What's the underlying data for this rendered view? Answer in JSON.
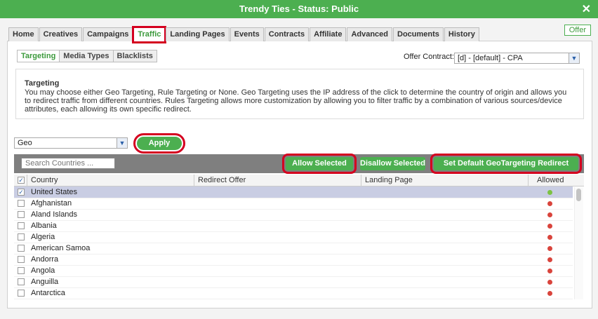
{
  "window": {
    "title": "Trendy Ties - Status: Public",
    "close": "✕"
  },
  "tabs": [
    {
      "label": "Home"
    },
    {
      "label": "Creatives"
    },
    {
      "label": "Campaigns"
    },
    {
      "label": "Traffic",
      "active": true
    },
    {
      "label": "Landing Pages"
    },
    {
      "label": "Events"
    },
    {
      "label": "Contracts"
    },
    {
      "label": "Affiliate"
    },
    {
      "label": "Advanced"
    },
    {
      "label": "Documents"
    },
    {
      "label": "History"
    }
  ],
  "offer_badge": "Offer",
  "subtabs": [
    {
      "label": "Targeting",
      "active": true
    },
    {
      "label": "Media Types"
    },
    {
      "label": "Blacklists"
    }
  ],
  "contract": {
    "label": "Offer Contract:",
    "value": "[d] - [default] - CPA"
  },
  "description": {
    "heading": "Targeting",
    "text": "You may choose either Geo Targeting, Rule Targeting or None. Geo Targeting uses the IP address of the click to determine the country of origin and allows you to redirect traffic from different countries. Rules Targeting allows more customization by allowing you to filter traffic by a combination of various sources/device attributes, each allowing its own specific redirect."
  },
  "targeting_type": {
    "value": "Geo"
  },
  "apply_label": "Apply",
  "search": {
    "placeholder": "Search Countries ..."
  },
  "actions": {
    "allow": "Allow Selected",
    "disallow": "Disallow Selected",
    "set_default": "Set Default GeoTargeting Redirect Offer"
  },
  "columns": {
    "country": "Country",
    "redirect": "Redirect Offer",
    "landing": "Landing Page",
    "allowed": "Allowed"
  },
  "colors": {
    "allowed": "#7cc242",
    "disallowed": "#d9443c",
    "accent": "#4caf50",
    "highlight": "#d4001f"
  },
  "rows": [
    {
      "country": "United States",
      "checked": true,
      "allowed": true
    },
    {
      "country": "Afghanistan",
      "checked": false,
      "allowed": false
    },
    {
      "country": "Aland Islands",
      "checked": false,
      "allowed": false
    },
    {
      "country": "Albania",
      "checked": false,
      "allowed": false
    },
    {
      "country": "Algeria",
      "checked": false,
      "allowed": false
    },
    {
      "country": "American Samoa",
      "checked": false,
      "allowed": false
    },
    {
      "country": "Andorra",
      "checked": false,
      "allowed": false
    },
    {
      "country": "Angola",
      "checked": false,
      "allowed": false
    },
    {
      "country": "Anguilla",
      "checked": false,
      "allowed": false
    },
    {
      "country": "Antarctica",
      "checked": false,
      "allowed": false
    }
  ]
}
